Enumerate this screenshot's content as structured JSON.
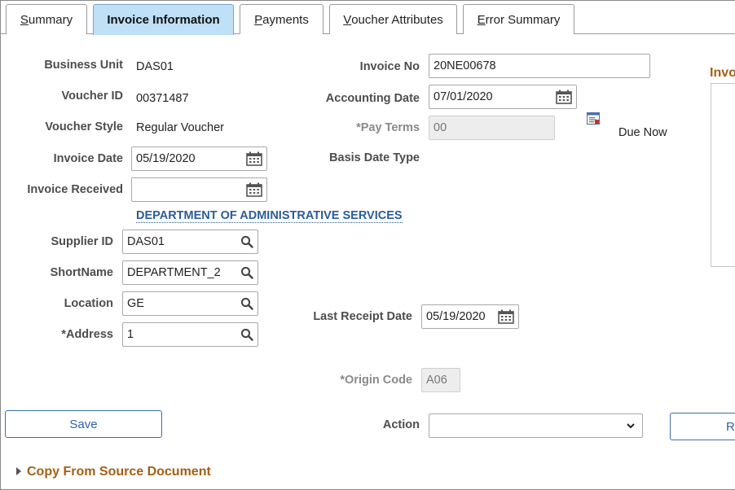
{
  "tabs": [
    {
      "label": "Summary",
      "accel": "S",
      "rest": "ummary"
    },
    {
      "label": "Invoice Information"
    },
    {
      "label": "Payments",
      "accel": "P",
      "rest": "ayments"
    },
    {
      "label": "Voucher Attributes",
      "accel": "V",
      "rest": "oucher Attributes"
    },
    {
      "label": "Error Summary",
      "accel": "E",
      "rest": "rror Summary"
    }
  ],
  "fields": {
    "business_unit": {
      "label": "Business Unit",
      "value": "DAS01"
    },
    "voucher_id": {
      "label": "Voucher ID",
      "value": "00371487"
    },
    "voucher_style": {
      "label": "Voucher Style",
      "value": "Regular Voucher"
    },
    "invoice_date": {
      "label": "Invoice Date",
      "value": "05/19/2020"
    },
    "invoice_received": {
      "label": "Invoice Received",
      "value": ""
    },
    "invoice_no": {
      "label": "Invoice No",
      "value": "20NE00678"
    },
    "accounting_date": {
      "label": "Accounting Date",
      "value": "07/01/2020"
    },
    "pay_terms": {
      "label": "*Pay Terms",
      "value": "00",
      "description": "Due Now"
    },
    "basis_date_type": {
      "label": "Basis Date Type"
    },
    "supplier_name": "DEPARTMENT OF ADMINISTRATIVE SERVICES",
    "supplier_id": {
      "label": "Supplier ID",
      "value": "DAS01"
    },
    "short_name": {
      "label": "ShortName",
      "value": "DEPARTMENT_2"
    },
    "location": {
      "label": "Location",
      "value": "GE"
    },
    "address": {
      "label": "*Address",
      "value": "1"
    },
    "last_receipt_date": {
      "label": "Last Receipt Date",
      "value": "05/19/2020"
    },
    "origin_code": {
      "label": "*Origin Code",
      "value": "A06"
    }
  },
  "side_panel_title": "Invo",
  "actions": {
    "save_label": "Save",
    "action_label": "Action",
    "action_value": "",
    "right_button_label": "R"
  },
  "copy_section": {
    "title": "Copy From Source Document"
  },
  "colors": {
    "active_tab": "#bfe0f7",
    "link": "#2b5c9a",
    "section": "#a55f14",
    "button_text": "#2f64a8"
  }
}
